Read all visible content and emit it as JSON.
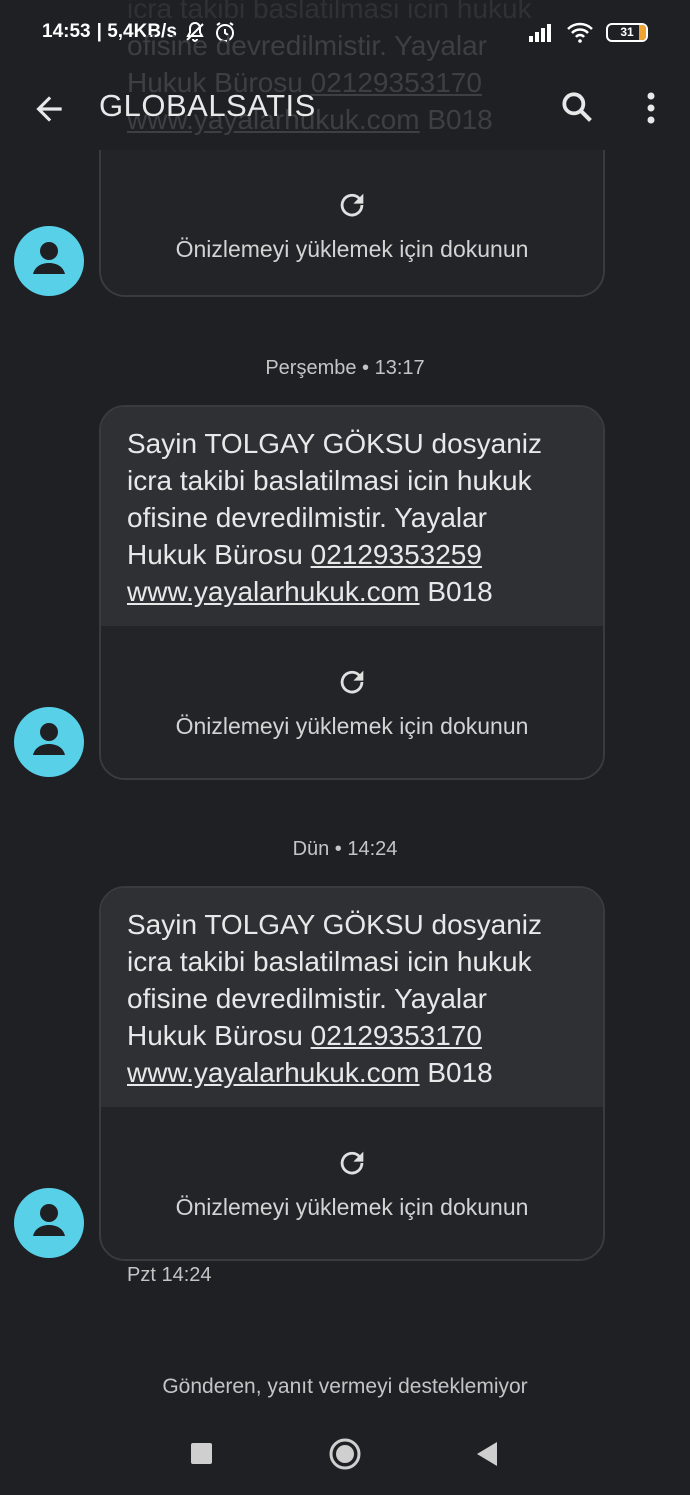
{
  "status_bar": {
    "time": "14:53",
    "network_speed": "| 5,4KB/s",
    "battery_level": "31",
    "icons": [
      "silent-bell-icon",
      "alarm-icon",
      "signal-icon",
      "wifi-icon",
      "battery-icon"
    ]
  },
  "app_bar": {
    "title": "GLOBALSATIS",
    "icons": [
      "back-arrow-icon",
      "search-icon",
      "more-vert-icon"
    ]
  },
  "ghost_text": {
    "line1": "icra takibi baslatilmasi icin hukuk",
    "line2": "ofisine devredilmistir. Yayalar",
    "line3_plain": "Hukuk Bürosu ",
    "line3_link": "02129353170",
    "line4_link": "www.yayalarhukuk.com",
    "line4_plain": " B018"
  },
  "preview_label": "Önizlemeyi yüklemek için dokunun",
  "conversation": [
    {
      "timestamp": "Perşembe • 13:17",
      "message": {
        "line1": "Sayin TOLGAY GÖKSU dosyaniz",
        "line2": "icra takibi baslatilmasi icin hukuk",
        "line3": "ofisine devredilmistir. Yayalar",
        "line4_plain": "Hukuk Bürosu ",
        "line4_link": "02129353259",
        "line5_link": "www.yayalarhukuk.com",
        "line5_plain": " B018"
      }
    },
    {
      "timestamp": "Dün • 14:24",
      "message": {
        "line1": "Sayin TOLGAY GÖKSU dosyaniz",
        "line2": "icra takibi baslatilmasi icin hukuk",
        "line3": "ofisine devredilmistir. Yayalar",
        "line4_plain": "Hukuk Bürosu ",
        "line4_link": "02129353170",
        "line5_link": "www.yayalarhukuk.com",
        "line5_plain": " B018"
      },
      "sub_time": "Pzt 14:24"
    }
  ],
  "footer_note": "Gönderen, yanıt vermeyi desteklemiyor",
  "nav_bar": {
    "icons": [
      "recents-square-icon",
      "home-circle-icon",
      "back-triangle-icon"
    ]
  },
  "colors": {
    "background": "#1f2024",
    "bubble": "#2f3034",
    "avatar": "#58d0e8",
    "battery_accent": "#f0a330"
  }
}
